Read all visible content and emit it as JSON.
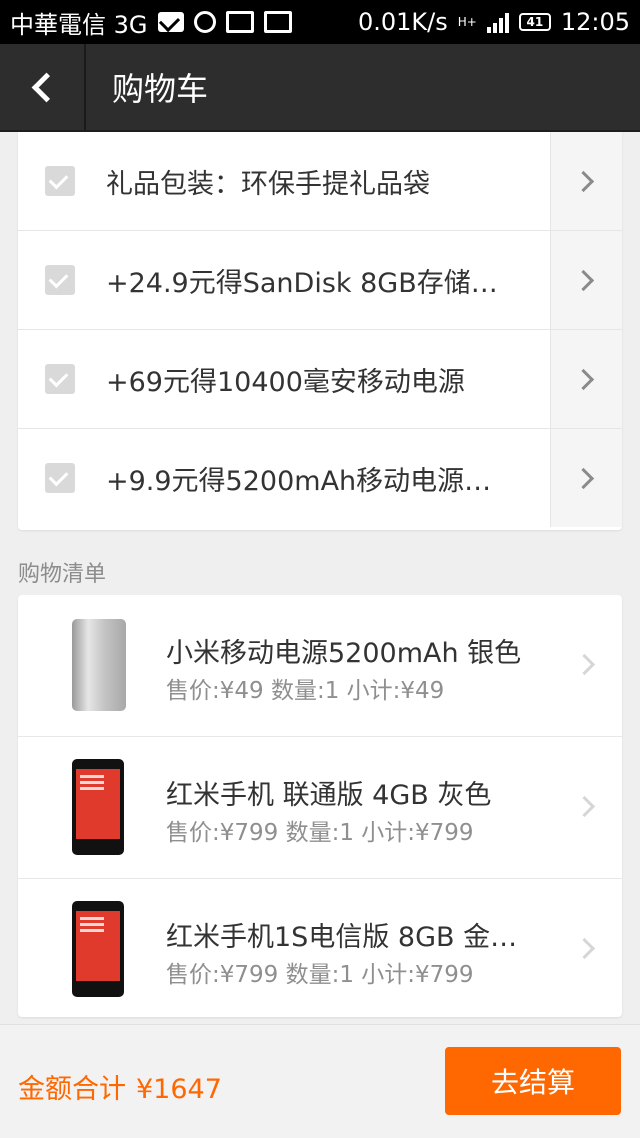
{
  "status_bar": {
    "carrier": "中華電信 3G",
    "speed": "0.01K/s",
    "network": "H+",
    "battery": "41",
    "time": "12:05"
  },
  "header": {
    "title": "购物车"
  },
  "promotions": [
    {
      "label": "礼品包装：环保手提礼品袋",
      "checked": true
    },
    {
      "label": "+24.9元得SanDisk 8GB存储…",
      "checked": true
    },
    {
      "label": "+69元得10400毫安移动电源",
      "checked": true
    },
    {
      "label": "+9.9元得5200mAh移动电源…",
      "checked": true
    }
  ],
  "shopping_list": {
    "label": "购物清单",
    "items": [
      {
        "name": "小米移动电源5200mAh 银色",
        "meta": "售价:¥49 数量:1 小计:¥49",
        "image": "power-bank"
      },
      {
        "name": "红米手机 联通版 4GB 灰色",
        "meta": "售价:¥799 数量:1 小计:¥799",
        "image": "phone"
      },
      {
        "name": "红米手机1S电信版 8GB 金…",
        "meta": "售价:¥799 数量:1 小计:¥799",
        "image": "phone"
      }
    ]
  },
  "footer": {
    "total_label": "金额合计",
    "total_amount": "¥1647",
    "checkout_label": "去结算",
    "accent": "#ff6700"
  }
}
